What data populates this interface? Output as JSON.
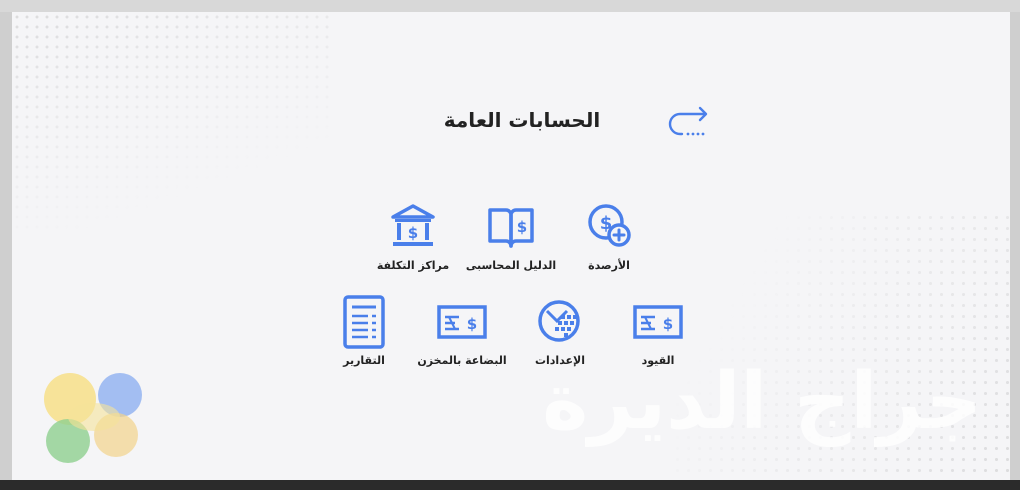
{
  "header": {
    "title": "الحسابات العامة",
    "back_icon": "back-arrow-icon"
  },
  "tiles": {
    "balances": {
      "label": "الأرصدة",
      "icon": "dollar-coin-plus-icon"
    },
    "chart_of_accounts": {
      "label": "الدليل المحاسبى",
      "icon": "book-dollar-icon"
    },
    "cost_centers": {
      "label": "مراكز التكلفة",
      "icon": "bank-building-icon"
    },
    "entries": {
      "label": "القيود",
      "icon": "cheque-icon"
    },
    "settings": {
      "label": "الإعدادات",
      "icon": "web-globe-icon"
    },
    "inventory_goods": {
      "label": "البضاعة بالمخزن",
      "icon": "cheque-icon"
    },
    "reports": {
      "label": "التقارير",
      "icon": "report-document-icon"
    }
  },
  "watermark": {
    "text": "جراج الديرة"
  },
  "colors": {
    "accent": "#4a7fea",
    "background": "#f5f5f7",
    "text": "#222222"
  }
}
